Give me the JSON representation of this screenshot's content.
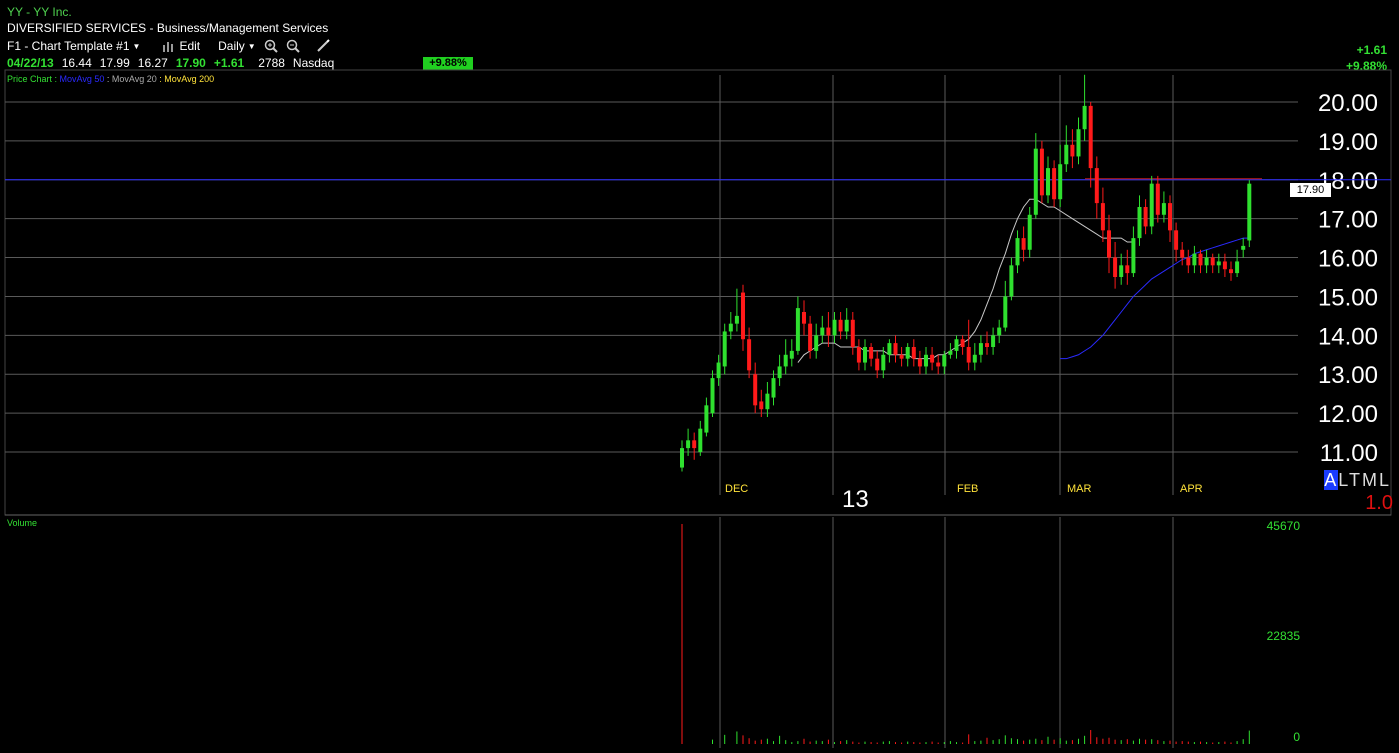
{
  "header": {
    "title": "YY - YY Inc.",
    "subtitle": "DIVERSIFIED SERVICES - Business/Management Services",
    "template": "F1 - Chart Template #1",
    "edit_label": "Edit",
    "period": "Daily"
  },
  "quote": {
    "date": "04/22/13",
    "open": "16.44",
    "high": "17.99",
    "low": "16.27",
    "close": "17.90",
    "change": "+1.61",
    "volume": "2788",
    "exchange": "Nasdaq",
    "pct_badge": "+9.88%",
    "change_top": "+1.61",
    "pct_top": "+9.88%"
  },
  "legend": {
    "price_chart": "Price Chart",
    "ma50": "MovAvg 50",
    "ma20": "MovAvg 20",
    "ma200": "MovAvg 200",
    "sep1": " : ",
    "sep2": " : ",
    "sep3": " : "
  },
  "right_panel": {
    "modes": [
      "A",
      "L",
      "T",
      "M",
      "L"
    ],
    "scale": "1.0",
    "last_price_tag": "17.90"
  },
  "year_label": "13",
  "volume_panel": {
    "title": "Volume",
    "ticks": [
      "45670",
      "22835",
      "0"
    ]
  },
  "colors": {
    "up": "#2fe02f",
    "down": "#ff1a1a",
    "ma50": "#2a2aff",
    "ma20": "#c8c8c8",
    "ma200": "#ffe23a",
    "grid": "#5a5a5a",
    "hline": "#2a2aff"
  },
  "chart_data": {
    "type": "candlestick",
    "y_ticks": [
      "20.00",
      "19.00",
      "18.00",
      "17.00",
      "16.00",
      "15.00",
      "14.00",
      "13.00",
      "12.00",
      "11.00"
    ],
    "ylim": [
      10.5,
      20.5
    ],
    "month_labels": [
      "DEC",
      "FEB",
      "MAR",
      "APR"
    ],
    "horizontal_line": 18.0,
    "candles": [
      [
        10.6,
        11.1,
        10.5,
        11.3
      ],
      [
        11.1,
        11.3,
        10.9,
        11.6
      ],
      [
        11.3,
        11.1,
        10.8,
        11.5
      ],
      [
        11.0,
        11.6,
        10.9,
        11.8
      ],
      [
        11.5,
        12.2,
        11.4,
        12.4
      ],
      [
        12.0,
        12.9,
        11.9,
        13.1
      ],
      [
        12.9,
        13.3,
        12.7,
        13.5
      ],
      [
        13.2,
        14.1,
        13.0,
        14.3
      ],
      [
        14.1,
        14.3,
        13.9,
        14.6
      ],
      [
        14.3,
        14.5,
        14.1,
        15.2
      ],
      [
        15.1,
        13.9,
        13.6,
        15.3
      ],
      [
        13.9,
        13.1,
        12.9,
        14.2
      ],
      [
        13.0,
        12.2,
        12.0,
        13.3
      ],
      [
        12.3,
        12.1,
        11.9,
        12.6
      ],
      [
        12.1,
        12.5,
        11.9,
        12.8
      ],
      [
        12.4,
        12.9,
        12.2,
        13.1
      ],
      [
        12.9,
        13.2,
        12.7,
        13.5
      ],
      [
        13.2,
        13.5,
        13.0,
        13.9
      ],
      [
        13.4,
        13.6,
        13.2,
        13.9
      ],
      [
        13.6,
        14.7,
        13.5,
        15.0
      ],
      [
        14.6,
        14.3,
        14.0,
        14.9
      ],
      [
        14.3,
        13.6,
        13.4,
        14.5
      ],
      [
        13.6,
        14.0,
        13.4,
        14.3
      ],
      [
        14.0,
        14.2,
        13.8,
        14.5
      ],
      [
        14.2,
        14.0,
        13.7,
        14.6
      ],
      [
        14.0,
        14.4,
        13.8,
        14.6
      ],
      [
        14.4,
        14.1,
        13.9,
        14.6
      ],
      [
        14.1,
        14.4,
        13.9,
        14.7
      ],
      [
        14.4,
        13.7,
        13.5,
        14.6
      ],
      [
        13.7,
        13.3,
        13.1,
        13.9
      ],
      [
        13.3,
        13.7,
        13.1,
        13.9
      ],
      [
        13.7,
        13.4,
        13.2,
        13.8
      ],
      [
        13.4,
        13.1,
        12.9,
        13.6
      ],
      [
        13.1,
        13.5,
        12.9,
        13.7
      ],
      [
        13.5,
        13.8,
        13.3,
        13.9
      ],
      [
        13.8,
        13.5,
        13.3,
        14.0
      ],
      [
        13.5,
        13.4,
        13.2,
        13.7
      ],
      [
        13.4,
        13.7,
        13.2,
        13.8
      ],
      [
        13.7,
        13.4,
        13.2,
        13.9
      ],
      [
        13.4,
        13.2,
        13.0,
        13.6
      ],
      [
        13.2,
        13.5,
        13.0,
        13.7
      ],
      [
        13.5,
        13.3,
        13.1,
        13.7
      ],
      [
        13.3,
        13.2,
        13.0,
        13.5
      ],
      [
        13.2,
        13.5,
        13.0,
        13.6
      ],
      [
        13.5,
        13.6,
        13.4,
        13.8
      ],
      [
        13.6,
        13.9,
        13.4,
        14.0
      ],
      [
        13.9,
        13.7,
        13.5,
        14.0
      ],
      [
        13.7,
        13.3,
        13.1,
        14.4
      ],
      [
        13.3,
        13.5,
        13.1,
        13.8
      ],
      [
        13.5,
        13.8,
        13.3,
        14.0
      ],
      [
        13.8,
        13.7,
        13.5,
        14.1
      ],
      [
        13.7,
        14.0,
        13.5,
        14.2
      ],
      [
        14.0,
        14.2,
        13.8,
        14.4
      ],
      [
        14.2,
        15.0,
        14.1,
        15.4
      ],
      [
        15.0,
        15.8,
        14.9,
        16.0
      ],
      [
        15.8,
        16.5,
        15.6,
        16.7
      ],
      [
        16.5,
        16.2,
        15.9,
        16.8
      ],
      [
        16.2,
        17.1,
        16.0,
        17.3
      ],
      [
        17.1,
        18.8,
        17.0,
        19.2
      ],
      [
        18.8,
        17.6,
        17.4,
        19.0
      ],
      [
        17.6,
        18.3,
        17.4,
        18.6
      ],
      [
        18.3,
        17.5,
        17.3,
        18.5
      ],
      [
        17.5,
        18.4,
        17.3,
        18.9
      ],
      [
        18.4,
        18.9,
        18.2,
        19.4
      ],
      [
        18.9,
        18.6,
        18.3,
        19.3
      ],
      [
        18.6,
        19.3,
        18.4,
        19.6
      ],
      [
        19.3,
        19.9,
        19.0,
        20.7
      ],
      [
        19.9,
        18.3,
        17.8,
        20.0
      ],
      [
        18.3,
        17.4,
        17.0,
        18.6
      ],
      [
        17.4,
        16.7,
        16.4,
        17.8
      ],
      [
        16.7,
        16.0,
        15.6,
        17.1
      ],
      [
        16.0,
        15.5,
        15.2,
        16.4
      ],
      [
        15.5,
        15.8,
        15.3,
        16.1
      ],
      [
        15.8,
        15.6,
        15.3,
        16.2
      ],
      [
        15.6,
        16.5,
        15.5,
        16.8
      ],
      [
        16.5,
        17.3,
        16.3,
        17.6
      ],
      [
        17.3,
        16.8,
        16.6,
        17.5
      ],
      [
        16.8,
        17.9,
        16.6,
        18.1
      ],
      [
        17.9,
        17.1,
        16.9,
        18.1
      ],
      [
        17.1,
        17.4,
        16.9,
        17.7
      ],
      [
        17.4,
        16.7,
        16.4,
        17.6
      ],
      [
        16.7,
        16.2,
        15.9,
        16.9
      ],
      [
        16.2,
        16.0,
        15.8,
        16.4
      ],
      [
        16.0,
        15.8,
        15.6,
        16.2
      ],
      [
        15.8,
        16.1,
        15.6,
        16.3
      ],
      [
        16.1,
        15.8,
        15.6,
        16.2
      ],
      [
        15.8,
        16.0,
        15.6,
        16.2
      ],
      [
        16.0,
        15.8,
        15.6,
        16.1
      ],
      [
        15.8,
        15.9,
        15.6,
        16.1
      ],
      [
        15.9,
        15.7,
        15.5,
        16.1
      ],
      [
        15.7,
        15.6,
        15.4,
        15.9
      ],
      [
        15.6,
        15.9,
        15.5,
        16.2
      ],
      [
        16.2,
        16.3,
        16.0,
        16.5
      ],
      [
        16.44,
        17.9,
        16.27,
        17.99
      ]
    ],
    "ma20": [
      13.3,
      13.5,
      13.6,
      13.7,
      13.8,
      13.8,
      13.8,
      13.7,
      13.7,
      13.7,
      13.7,
      13.6,
      13.6,
      13.6,
      13.6,
      13.5,
      13.5,
      13.5,
      13.5,
      13.4,
      13.4,
      13.4,
      13.4,
      13.5,
      13.5,
      13.6,
      13.7,
      13.8,
      13.9,
      14.1,
      14.4,
      14.8,
      15.2,
      15.7,
      16.1,
      16.6,
      17.0,
      17.3,
      17.5,
      17.5,
      17.4,
      17.3,
      17.3,
      17.2,
      17.1,
      17.0,
      16.9,
      16.8,
      16.7,
      16.6,
      16.5,
      16.5,
      16.5,
      16.5,
      16.4,
      16.4
    ],
    "ma50": [
      13.4,
      13.4,
      13.45,
      13.5,
      13.6,
      13.7,
      13.85,
      14.0,
      14.2,
      14.4,
      14.6,
      14.8,
      15.0,
      15.15,
      15.3,
      15.45,
      15.55,
      15.65,
      15.75,
      15.85,
      15.95,
      16.0,
      16.1,
      16.15,
      16.2,
      16.25,
      16.3,
      16.35,
      16.4,
      16.45,
      16.5,
      16.5
    ],
    "volume": [
      45670,
      0,
      0,
      0,
      0,
      900,
      0,
      1900,
      0,
      2600,
      1800,
      1200,
      700,
      900,
      1100,
      600,
      1700,
      800,
      400,
      600,
      1100,
      500,
      700,
      600,
      900,
      400,
      600,
      800,
      500,
      300,
      500,
      400,
      300,
      500,
      600,
      400,
      300,
      500,
      400,
      300,
      400,
      500,
      300,
      400,
      600,
      400,
      300,
      2000,
      600,
      700,
      1300,
      800,
      1000,
      1800,
      1200,
      1000,
      700,
      900,
      1100,
      800,
      1500,
      900,
      1200,
      700,
      800,
      1100,
      1700,
      2900,
      1400,
      1100,
      1300,
      900,
      800,
      1000,
      700,
      1100,
      900,
      1000,
      800,
      600,
      700,
      500,
      600,
      500,
      400,
      500,
      400,
      300,
      400,
      500,
      300,
      600,
      1000,
      2788
    ]
  }
}
